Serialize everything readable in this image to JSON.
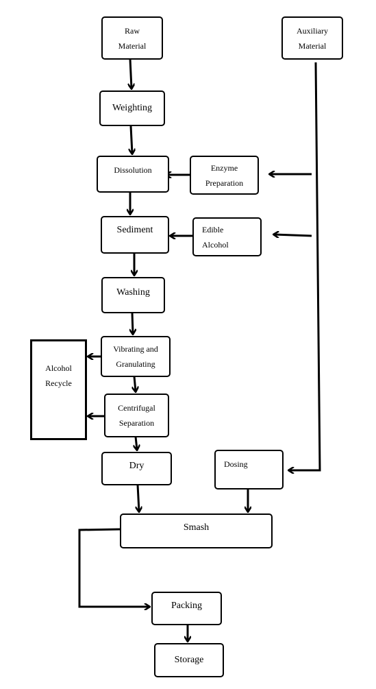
{
  "nodes": {
    "raw_material": [
      "Raw",
      "Material"
    ],
    "auxiliary_material": [
      "Auxiliary",
      "Material"
    ],
    "weighting": "Weighting",
    "dissolution": "Dissolution",
    "enzyme_preparation": [
      "Enzyme",
      "Preparation"
    ],
    "sediment": "Sediment",
    "edible_alcohol": [
      "Edible",
      "Alcohol"
    ],
    "washing": "Washing",
    "vibrating_granulating": [
      "Vibrating and",
      "Granulating"
    ],
    "alcohol_recycle": [
      "Alcohol",
      "Recycle"
    ],
    "centrifugal_separation": [
      "Centrifugal",
      "Separation"
    ],
    "dry": "Dry",
    "dosing": "Dosing",
    "smash": "Smash",
    "packing": "Packing",
    "storage": "Storage"
  }
}
